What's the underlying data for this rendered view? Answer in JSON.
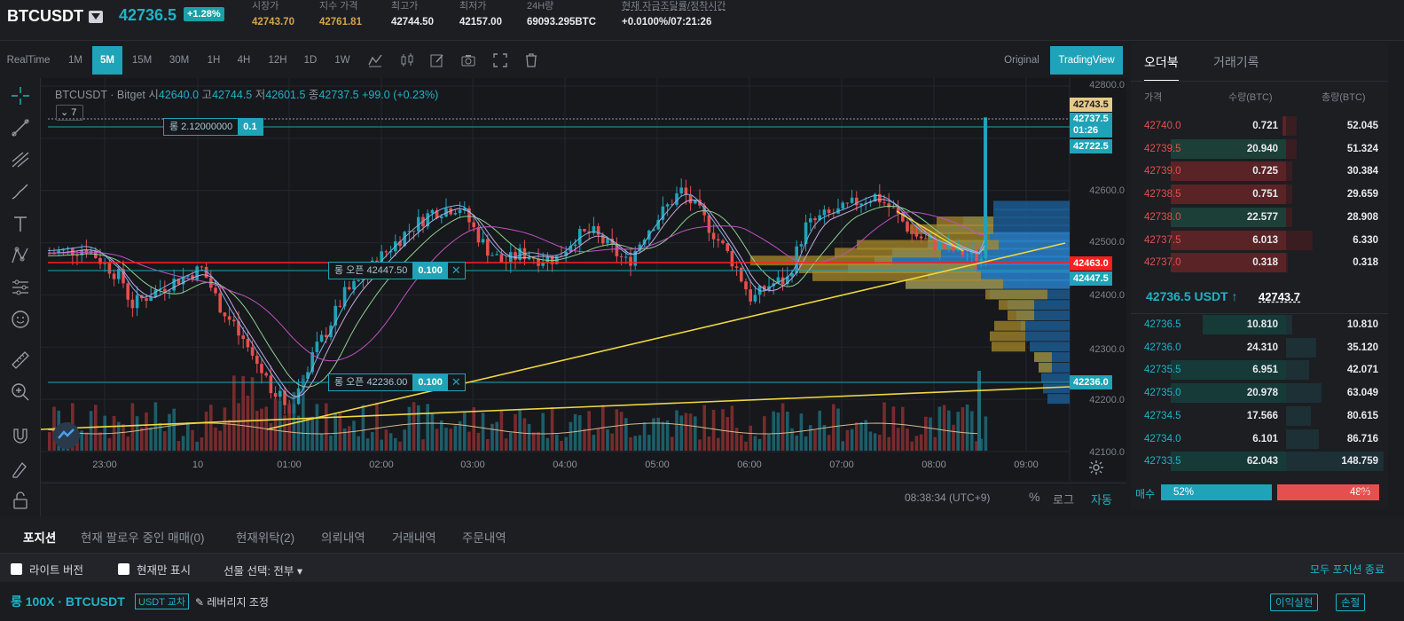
{
  "header": {
    "symbol": "BTCUSDT",
    "price": "42736.5",
    "change": "+1.28%",
    "stats": [
      {
        "label": "시장가",
        "value": "42743.70",
        "tone": "gold"
      },
      {
        "label": "지수 가격",
        "value": "42761.81",
        "tone": "gold"
      },
      {
        "label": "최고가",
        "value": "42744.50",
        "tone": "white"
      },
      {
        "label": "최저가",
        "value": "42157.00",
        "tone": "white"
      },
      {
        "label": "24H량",
        "value": "69093.295BTC",
        "tone": "white"
      },
      {
        "label": "현재 자금조달률/정착시간",
        "value": "+0.0100%/07:21:26",
        "tone": "white"
      }
    ]
  },
  "timeframes": [
    "RealTime",
    "1M",
    "5M",
    "15M",
    "30M",
    "1H",
    "4H",
    "12H",
    "1D",
    "1W"
  ],
  "active_timeframe": "5M",
  "views": {
    "original": "Original",
    "tradingview": "TradingView"
  },
  "chart": {
    "title_symbol": "BTCUSDT · Bitget",
    "open_label": "시",
    "open": "42640.0",
    "high_label": "고",
    "high": "42744.5",
    "low_label": "저",
    "low": "42601.5",
    "close_label": "종",
    "close": "42737.5",
    "change": "+99.0 (+0.23%)",
    "collapse": "7",
    "y_ticks": [
      "42800.0",
      "42600.0",
      "42500.0",
      "42400.0",
      "42300.0",
      "42200.0",
      "42100.0"
    ],
    "x_ticks": [
      "23:00",
      "10",
      "01:00",
      "02:00",
      "03:00",
      "04:00",
      "05:00",
      "06:00",
      "07:00",
      "08:00",
      "09:00"
    ],
    "price_labels": {
      "p1": "42743.5",
      "p2a": "42737.5",
      "p2b": "01:26",
      "p3": "42722.5",
      "p4": "42463.0",
      "p5": "42447.5",
      "p6": "42236.0"
    },
    "orders": [
      {
        "label": "롱 2.12000000",
        "qty": "0.1"
      },
      {
        "label": "롱 오픈 42447.50",
        "qty": "0.100",
        "close": "✕"
      },
      {
        "label": "롱 오픈 42236.00",
        "qty": "0.100",
        "close": "✕"
      }
    ],
    "footer": {
      "time": "08:38:34 (UTC+9)",
      "pct": "%",
      "log": "로그",
      "auto": "자동"
    }
  },
  "orderbook": {
    "tabs": [
      "오더북",
      "거래기록"
    ],
    "headers": {
      "price": "가격",
      "qty": "수량(BTC)",
      "total": "총량(BTC)"
    },
    "asks": [
      {
        "price": "42740.0",
        "qty": "0.721",
        "total": "52.045",
        "qfill": 0.03,
        "tfill": 0.11
      },
      {
        "price": "42739.5",
        "qty": "20.940",
        "total": "51.324",
        "qfill": 1.0,
        "tfill": 0.11,
        "alt": true
      },
      {
        "price": "42739.0",
        "qty": "0.725",
        "total": "30.384",
        "qfill": 1.0,
        "tfill": 0.06
      },
      {
        "price": "42738.5",
        "qty": "0.751",
        "total": "29.659",
        "qfill": 1.0,
        "tfill": 0.06
      },
      {
        "price": "42738.0",
        "qty": "22.577",
        "total": "28.908",
        "qfill": 1.0,
        "tfill": 0.06,
        "alt": true
      },
      {
        "price": "42737.5",
        "qty": "6.013",
        "total": "6.330",
        "qfill": 1.0,
        "tfill": 0.27
      },
      {
        "price": "42737.0",
        "qty": "0.318",
        "total": "0.318",
        "qfill": 1.0,
        "tfill": 0.02
      }
    ],
    "mid_price": "42736.5 USDT ↑",
    "mid_index": "42743.7",
    "bids": [
      {
        "price": "42736.5",
        "qty": "10.810",
        "total": "10.810",
        "qfill": 0.72,
        "tfill": 0.06
      },
      {
        "price": "42736.0",
        "qty": "24.310",
        "total": "35.120",
        "qfill": 0.0,
        "tfill": 0.31
      },
      {
        "price": "42735.5",
        "qty": "6.951",
        "total": "42.071",
        "qfill": 1.0,
        "tfill": 0.24
      },
      {
        "price": "42735.0",
        "qty": "20.978",
        "total": "63.049",
        "qfill": 1.0,
        "tfill": 0.36
      },
      {
        "price": "42734.5",
        "qty": "17.566",
        "total": "80.615",
        "qfill": 0.0,
        "tfill": 0.25
      },
      {
        "price": "42734.0",
        "qty": "6.101",
        "total": "86.716",
        "qfill": 0.0,
        "tfill": 0.34
      },
      {
        "price": "42733.5",
        "qty": "62.043",
        "total": "148.759",
        "qfill": 1.0,
        "tfill": 1.0
      }
    ],
    "buy_label": "매수",
    "sell_label": "매도",
    "buy_pct": "52%",
    "sell_pct": "48%"
  },
  "bottom": {
    "tabs": [
      "포지션",
      "현재 팔로우 중인 매매(0)",
      "현재위탁(2)",
      "의뢰내역",
      "거래내역",
      "주문내역"
    ],
    "lite": "라이트 버전",
    "current_only": "현재만 표시",
    "futures": "선물 선택: 전부 ▾",
    "close_all": "모두 포지션 종료",
    "position_title": "롱 100X · BTCUSDT",
    "position_badge": "USDT 교차",
    "leverage": "✎ 레버리지 조정",
    "take_profit": "이익실현",
    "stop_loss": "손절"
  },
  "colors": {
    "accent": "#1fa3b8",
    "up": "#1fb3c6",
    "down": "#e54f4f",
    "gold": "#d6a44a"
  }
}
